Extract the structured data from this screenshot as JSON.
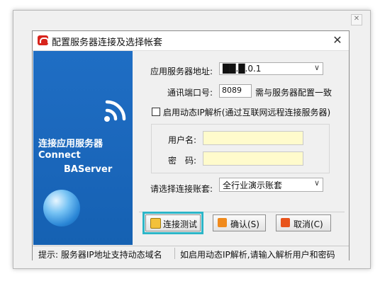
{
  "window": {
    "title": "配置服务器连接及选择帐套",
    "close_glyph": "✕",
    "outer_close_glyph": "✕"
  },
  "side_panel": {
    "line1": "连接应用服务器",
    "line2": "Connect",
    "line3": "BAServer"
  },
  "form": {
    "server_label": "应用服务器地址:",
    "server_value": "██.█.0.1",
    "port_label": "通讯端口号:",
    "port_value": "8089",
    "port_hint": "需与服务器配置一致",
    "dynamic_ip_label": "启用动态IP解析(通过互联网远程连接服务器)",
    "dynamic_ip_checked": false,
    "username_label": "用户名:",
    "username_value": "",
    "password_label": "密　码:",
    "password_value": "",
    "account_label": "请选择连接账套:",
    "account_value": "全行业演示账套"
  },
  "buttons": {
    "test": "连接测试",
    "ok": "确认(S)",
    "cancel": "取消(C)"
  },
  "status": {
    "left": "提示: 服务器IP地址支持动态域名",
    "right": "如启用动态IP解析,请输入解析用户和密码"
  },
  "colors": {
    "side_panel": "#1a66ba",
    "app_icon": "#d8241c",
    "focus_ring": "#2cb6c8",
    "credential_fill": "#fffbcc"
  }
}
